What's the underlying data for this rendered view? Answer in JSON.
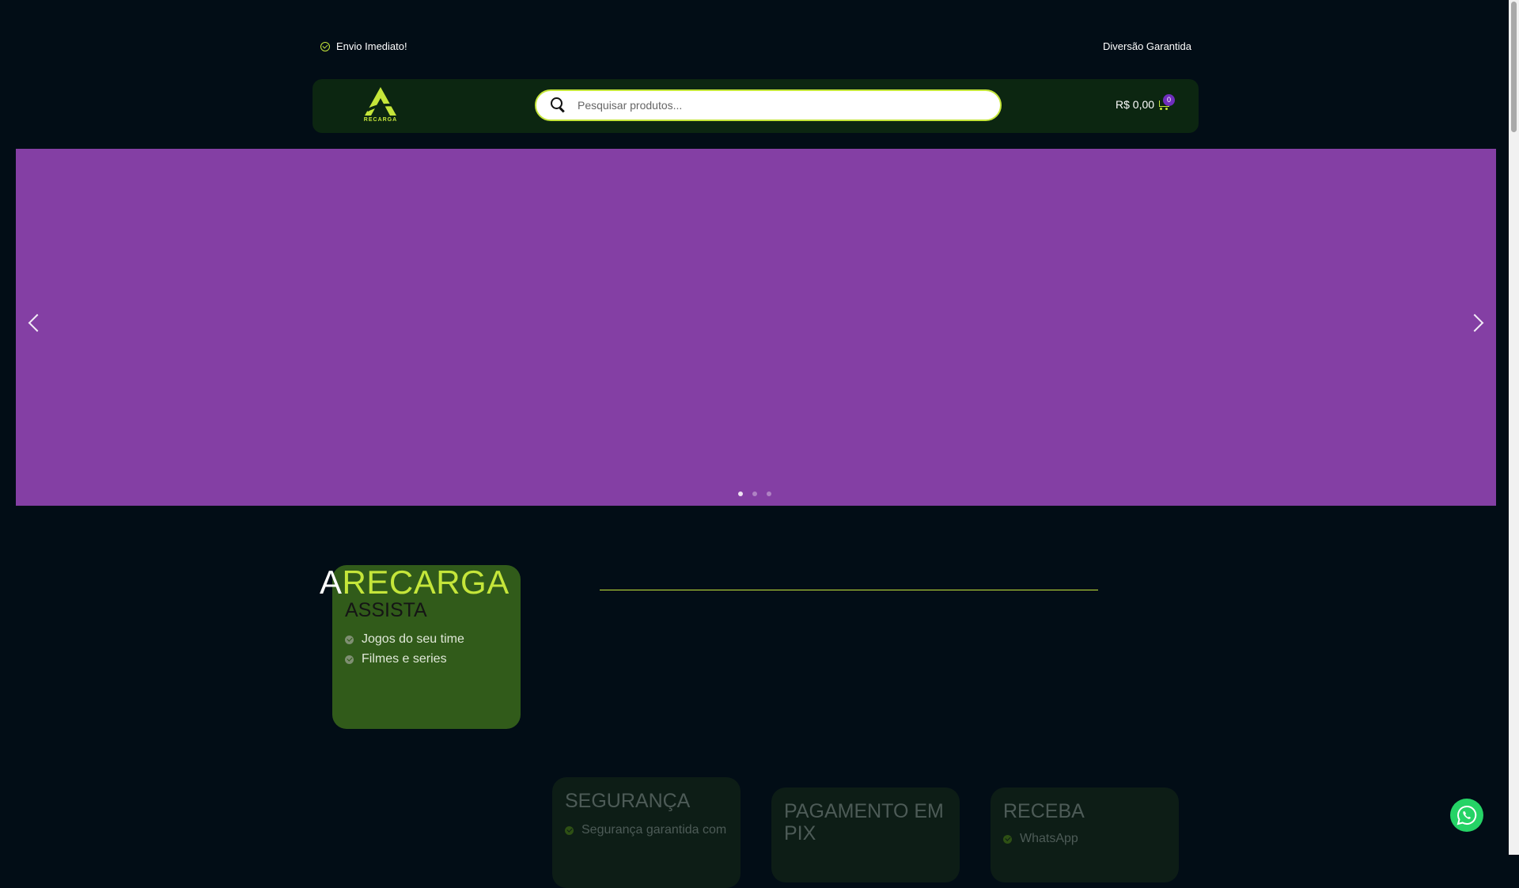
{
  "topbar": {
    "left_text": "Envio Imediato!",
    "right_text": "Diversão Garantida"
  },
  "header": {
    "logo_text": "RECARGA",
    "search": {
      "placeholder": "Pesquisar produtos..."
    },
    "cart": {
      "total": "R$ 0,00",
      "count": "0"
    }
  },
  "hero": {
    "slides_total": 3,
    "active_slide": 1,
    "background_color": "#843fa4"
  },
  "section": {
    "title_prefix": "A",
    "title_highlight": "RECARGA",
    "accent_color": "#c5e63a"
  },
  "cards": [
    {
      "title": "ASSISTA",
      "items": [
        "Jogos do seu time",
        "Filmes e series"
      ]
    },
    {
      "title": "SEGURANÇA",
      "items": [
        "Segurança garantida com"
      ]
    },
    {
      "title": "PAGAMENTO EM PIX",
      "items": []
    },
    {
      "title": "RECEBA",
      "items": [
        "WhatsApp"
      ]
    }
  ],
  "icons": [
    "check-circle-icon",
    "search-icon",
    "cart-icon",
    "chevron-left-icon",
    "chevron-right-icon",
    "whatsapp-icon"
  ]
}
